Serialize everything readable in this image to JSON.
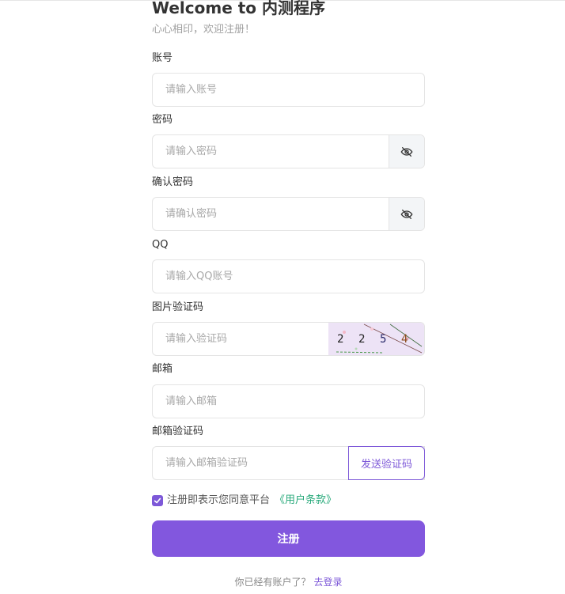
{
  "header": {
    "title": "Welcome to 内测程序",
    "subtitle": "心心相印，欢迎注册！"
  },
  "form": {
    "account": {
      "label": "账号",
      "placeholder": "请输入账号"
    },
    "password": {
      "label": "密码",
      "placeholder": "请输入密码",
      "toggle_icon": "eye-off-icon"
    },
    "confirm_password": {
      "label": "确认密码",
      "placeholder": "请确认密码",
      "toggle_icon": "eye-off-icon"
    },
    "qq": {
      "label": "QQ",
      "placeholder": "请输入QQ账号"
    },
    "image_captcha": {
      "label": "图片验证码",
      "placeholder": "请输入验证码",
      "captcha_text": [
        "2",
        "2",
        "5",
        "4"
      ]
    },
    "email": {
      "label": "邮箱",
      "placeholder": "请输入邮箱"
    },
    "email_code": {
      "label": "邮箱验证码",
      "placeholder": "请输入邮箱验证码",
      "send_button": "发送验证码"
    }
  },
  "agreement": {
    "checked": true,
    "text": "注册即表示您同意平台",
    "link": "《用户条款》"
  },
  "submit_label": "注册",
  "footer": {
    "text": "你已经有账户了？",
    "link": "去登录"
  },
  "colors": {
    "accent": "#8257de",
    "link_green": "#27a97a",
    "captcha_bg": "#ede3f6"
  }
}
